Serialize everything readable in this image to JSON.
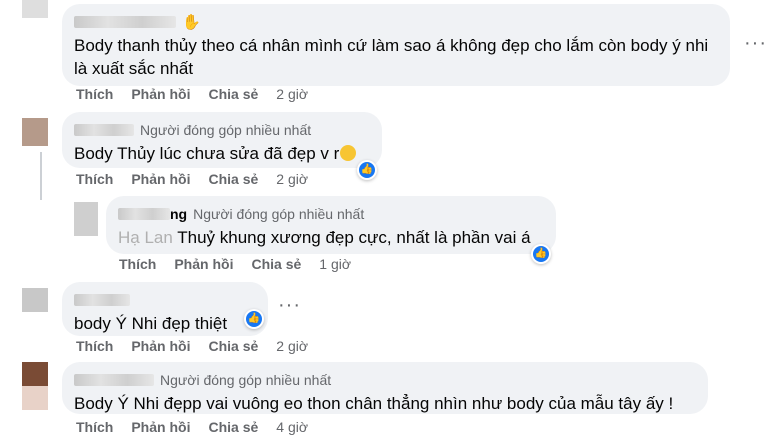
{
  "comments": [
    {
      "text": "Body thanh thủy theo cá nhân mình cứ làm sao á không đẹp cho lắm còn body ý nhi là xuất sắc nhất",
      "time": "2 giờ"
    },
    {
      "badge": "Người đóng góp nhiều nhất",
      "text": "Body Thủy lúc chưa sửa đã đẹp v r",
      "time": "2 giờ"
    },
    {
      "badge": "Người đóng góp nhiều nhất",
      "name_tail": "ng",
      "text_prefix": "Hạ Lan ",
      "text": "Thuỷ khung xương đẹp cực, nhất là phần vai á",
      "time": "1 giờ"
    },
    {
      "text": "body Ý Nhi đẹp thiệt",
      "time": "2 giờ"
    },
    {
      "badge": "Người đóng góp nhiều nhất",
      "text": "Body Ý Nhi đẹpp vai vuông eo thon chân thẳng nhìn như body của mẫu tây ấy !",
      "time": "4 giờ"
    }
  ],
  "actions": {
    "like": "Thích",
    "reply": "Phản hồi",
    "share": "Chia sẻ"
  },
  "more_glyph": "···",
  "icons": {
    "like": "thumbs-up-icon",
    "hand": "hand-icon",
    "more": "more-dots-icon",
    "emoji": "crying-emoji-icon"
  },
  "colors": {
    "bubble": "#f0f2f5",
    "secondary_text": "#65676b",
    "like_blue": "#1877f2"
  }
}
